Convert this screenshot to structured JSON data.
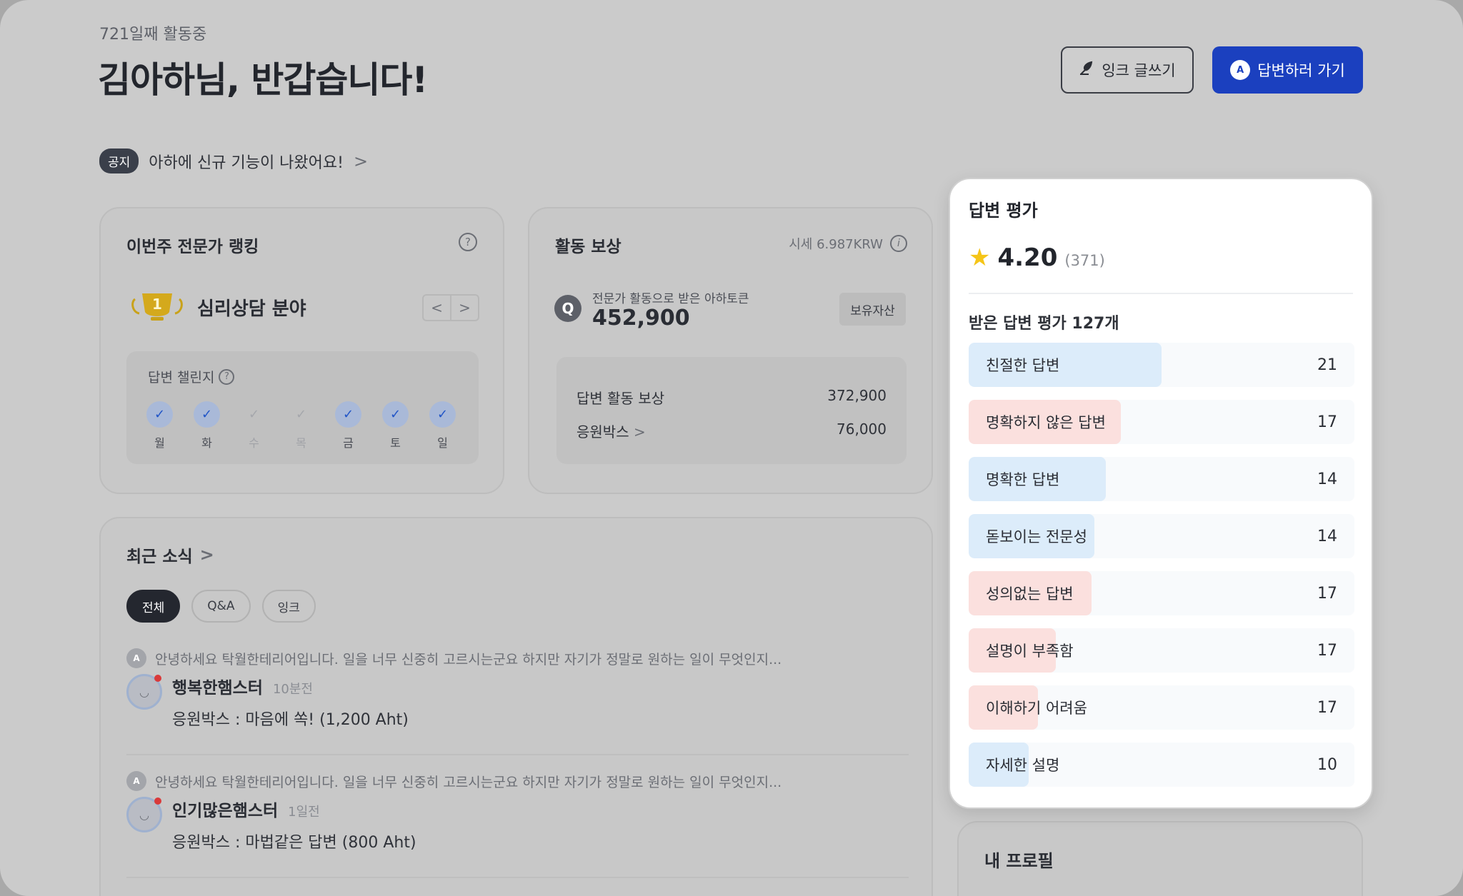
{
  "header": {
    "days_active": "721일째 활동중",
    "greeting": "김아하님, 반갑습니다!",
    "write_button": "잉크 글쓰기",
    "answer_button": "답변하러 가기",
    "answer_button_icon": "A"
  },
  "notice": {
    "badge": "공지",
    "text": "아하에 신규 기능이 나왔어요!",
    "chevron": ">"
  },
  "ranking": {
    "title": "이번주 전문가 랭킹",
    "help": "?",
    "rank_number": "1",
    "field": "심리상담 분야",
    "prev": "<",
    "next": ">",
    "challenge_label": "답변 챌린지",
    "days": [
      {
        "name": "월",
        "done": true
      },
      {
        "name": "화",
        "done": true
      },
      {
        "name": "수",
        "done": false
      },
      {
        "name": "목",
        "done": false
      },
      {
        "name": "금",
        "done": true
      },
      {
        "name": "토",
        "done": true
      },
      {
        "name": "일",
        "done": true
      }
    ]
  },
  "reward": {
    "title": "활동 보상",
    "rate": "시세 6.987KRW",
    "info": "i",
    "token_icon": "Q",
    "token_label": "전문가 활동으로 받은 아하토큰",
    "token_value": "452,900",
    "asset_button": "보유자산",
    "rows": [
      {
        "label": "답변 활동 보상",
        "value": "372,900"
      },
      {
        "label": "응원박스",
        "value": "76,000"
      }
    ]
  },
  "news": {
    "title": "최근 소식",
    "chips": [
      {
        "label": "전체",
        "active": true
      },
      {
        "label": "Q&A",
        "active": false
      },
      {
        "label": "잉크",
        "active": false
      }
    ],
    "items": [
      {
        "question": "안녕하세요 탁월한테리어입니다. 일을 너무 신중히 고르시는군요 하지만 자기가 정말로 원하는 일이 무엇인지...",
        "user": "행복한햄스터",
        "time": "10분전",
        "message": "응원박스 : 마음에 쏙! (1,200 Aht)"
      },
      {
        "question": "안녕하세요 탁월한테리어입니다. 일을 너무 신중히 고르시는군요 하지만 자기가 정말로 원하는 일이 무엇인지...",
        "user": "인기많은햄스터",
        "time": "1일전",
        "message": "응원박스 : 마법같은 답변 (800 Aht)"
      }
    ]
  },
  "evaluation": {
    "title": "답변 평가",
    "rating": "4.20",
    "rating_count": "(371)",
    "subtitle": "받은 답변 평가 127개",
    "bars": [
      {
        "label": "친절한 답변",
        "count": 21,
        "tone": "blue",
        "fill": 0.5
      },
      {
        "label": "명확하지 않은 답변",
        "count": 17,
        "tone": "red",
        "fill": 0.395
      },
      {
        "label": "명확한 답변",
        "count": 14,
        "tone": "blue",
        "fill": 0.355
      },
      {
        "label": "돋보이는 전문성",
        "count": 14,
        "tone": "blue",
        "fill": 0.325
      },
      {
        "label": "성의없는 답변",
        "count": 17,
        "tone": "red",
        "fill": 0.318
      },
      {
        "label": "설명이 부족함",
        "count": 17,
        "tone": "red",
        "fill": 0.225
      },
      {
        "label": "이해하기 어려움",
        "count": 17,
        "tone": "red",
        "fill": 0.18
      },
      {
        "label": "자세한 설명",
        "count": 10,
        "tone": "blue",
        "fill": 0.155
      }
    ]
  },
  "profile": {
    "title": "내 프로필"
  },
  "colors": {
    "primary": "#1b40bf",
    "bar_blue": "#dcecfa",
    "bar_red": "#fbe0de",
    "star": "#f5c518"
  }
}
